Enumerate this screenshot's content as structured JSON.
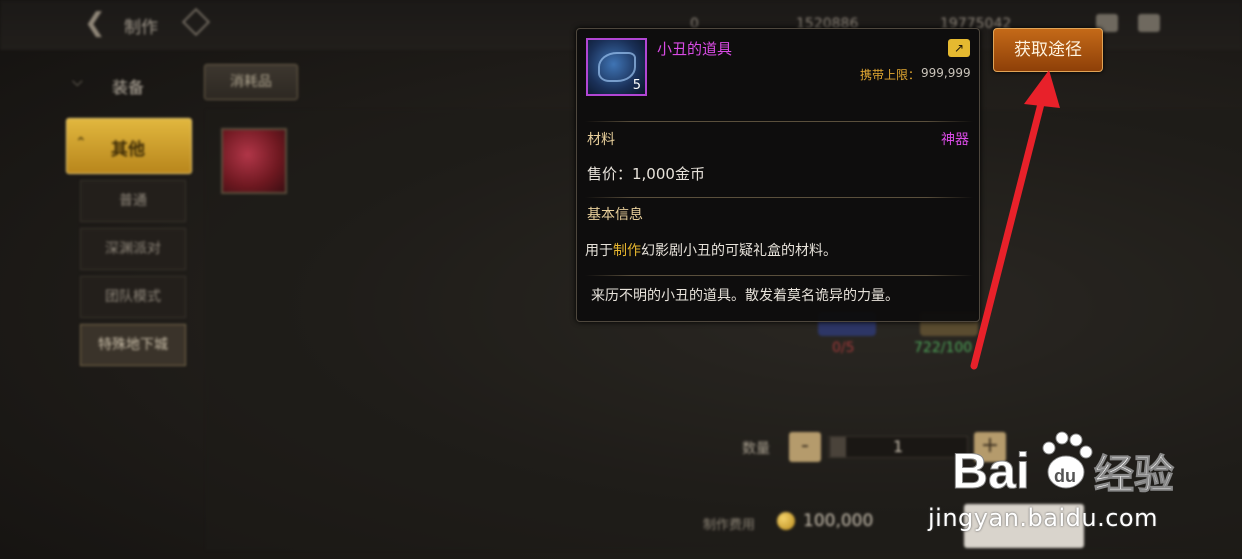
{
  "topbar": {
    "title": "制作",
    "res_1": "0",
    "res_2": "1520886",
    "res_3": "19775042"
  },
  "nav": {
    "category": "装备",
    "selected_category": "其他",
    "sub_items": [
      "普通",
      "深渊派对",
      "团队模式",
      "特殊地下城"
    ]
  },
  "tabs": {
    "consumable": "消耗品"
  },
  "materials": {
    "mat1_count": "0/5",
    "mat2_count": "722/100"
  },
  "craft": {
    "qty_label": "数量",
    "qty_value": "1",
    "qty_minus": "-",
    "qty_plus": "+",
    "cost_label": "制作费用",
    "cost_value": "100,000"
  },
  "tooltip": {
    "item_name": "小丑的道具",
    "item_count": "5",
    "limit_label": "携带上限：",
    "limit_value": "999,999",
    "type": "材料",
    "rarity": "神器",
    "price_label": "售价：",
    "price_value": "1,000金币",
    "basic_title": "基本信息",
    "desc_prefix": "用于",
    "desc_highlight": "制作",
    "desc_suffix": "幻影剧小丑的可疑礼盒的材料。",
    "lore": "来历不明的小丑的道具。散发着莫名诡异的力量。",
    "rarity_color": "#d84be4"
  },
  "acquire_button": {
    "label": "获取途径"
  },
  "watermark": {
    "logo_text": "Bai",
    "logo_text_2": "du",
    "logo_cn": "经验",
    "url": "jingyan.baidu.com"
  },
  "colors": {
    "accent_gold": "#e1b73e",
    "annotation_red": "#e8212a",
    "acquire_orange": "#c46a18"
  },
  "icons": [
    "back-arrow-icon",
    "diamond-icon",
    "share-icon",
    "coin-icon",
    "chevron-down-icon",
    "chevron-up-icon",
    "mail-icon",
    "chat-icon"
  ]
}
